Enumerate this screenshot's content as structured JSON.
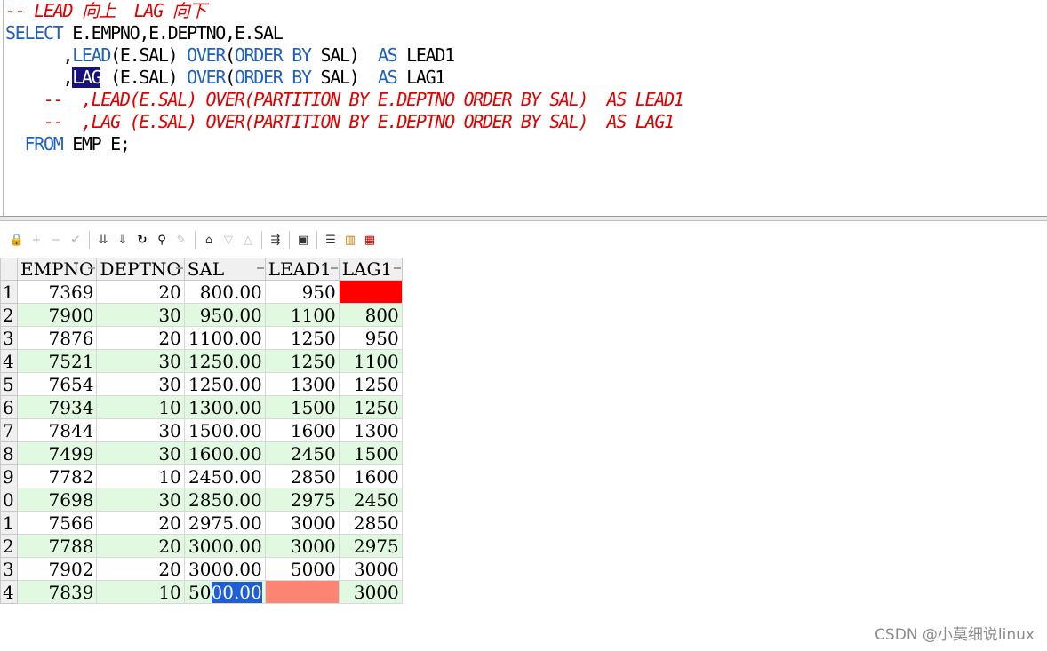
{
  "editor": {
    "lines": [
      {
        "segments": [
          {
            "t": "-- LEAD 向上  LAG 向下",
            "c": "cmt"
          }
        ]
      },
      {
        "segments": [
          {
            "t": "SELECT",
            "c": "kw"
          },
          {
            "t": " E.EMPNO,E.DEPTNO,E.SAL",
            "c": ""
          }
        ]
      },
      {
        "segments": [
          {
            "t": "      ,",
            "c": ""
          },
          {
            "t": "LEAD",
            "c": "kw"
          },
          {
            "t": "(E.SAL) ",
            "c": ""
          },
          {
            "t": "OVER",
            "c": "kw"
          },
          {
            "t": "(",
            "c": ""
          },
          {
            "t": "ORDER BY",
            "c": "kw"
          },
          {
            "t": " SAL)  ",
            "c": ""
          },
          {
            "t": "AS",
            "c": "kw"
          },
          {
            "t": " LEAD1",
            "c": ""
          }
        ]
      },
      {
        "segments": [
          {
            "t": "      ,",
            "c": ""
          },
          {
            "t": "LAG",
            "c": "sel"
          },
          {
            "t": " (E.SAL) ",
            "c": ""
          },
          {
            "t": "OVER",
            "c": "kw"
          },
          {
            "t": "(",
            "c": ""
          },
          {
            "t": "ORDER BY",
            "c": "kw"
          },
          {
            "t": " SAL)  ",
            "c": ""
          },
          {
            "t": "AS",
            "c": "kw"
          },
          {
            "t": " LAG1",
            "c": ""
          }
        ]
      },
      {
        "segments": [
          {
            "t": "    --  ,LEAD(E.SAL) OVER(PARTITION BY E.DEPTNO ORDER BY SAL)  AS LEAD1",
            "c": "cmt"
          }
        ]
      },
      {
        "segments": [
          {
            "t": "    --  ,LAG (E.SAL) OVER(PARTITION BY E.DEPTNO ORDER BY SAL)  AS LAG1",
            "c": "cmt"
          }
        ]
      },
      {
        "segments": [
          {
            "t": "  ",
            "c": ""
          },
          {
            "t": "FROM",
            "c": "kw"
          },
          {
            "t": " EMP E;",
            "c": ""
          }
        ]
      }
    ]
  },
  "toolbar": {
    "icons": [
      "lock-icon",
      "add-row-icon",
      "delete-row-icon",
      "post-changes-icon",
      "|",
      "next-page-icon",
      "last-page-icon",
      "refresh-icon",
      "find-icon",
      "clear-icon",
      "|",
      "query-by-example-icon",
      "sort-desc-icon",
      "sort-asc-icon",
      "|",
      "export-icon",
      "|",
      "save-icon",
      "|",
      "single-record-icon",
      "chart-icon",
      "grid-options-icon"
    ]
  },
  "grid": {
    "columns": [
      "EMPNO",
      "DEPTNO",
      "SAL",
      "LEAD1",
      "LAG1"
    ],
    "rows": [
      {
        "n": "1",
        "empno": "7369",
        "deptno": "20",
        "sal": "800.00",
        "lead1": "950",
        "lag1": ""
      },
      {
        "n": "2",
        "empno": "7900",
        "deptno": "30",
        "sal": "950.00",
        "lead1": "1100",
        "lag1": "800"
      },
      {
        "n": "3",
        "empno": "7876",
        "deptno": "20",
        "sal": "1100.00",
        "lead1": "1250",
        "lag1": "950"
      },
      {
        "n": "4",
        "empno": "7521",
        "deptno": "30",
        "sal": "1250.00",
        "lead1": "1250",
        "lag1": "1100"
      },
      {
        "n": "5",
        "empno": "7654",
        "deptno": "30",
        "sal": "1250.00",
        "lead1": "1300",
        "lag1": "1250"
      },
      {
        "n": "6",
        "empno": "7934",
        "deptno": "10",
        "sal": "1300.00",
        "lead1": "1500",
        "lag1": "1250"
      },
      {
        "n": "7",
        "empno": "7844",
        "deptno": "30",
        "sal": "1500.00",
        "lead1": "1600",
        "lag1": "1300"
      },
      {
        "n": "8",
        "empno": "7499",
        "deptno": "30",
        "sal": "1600.00",
        "lead1": "2450",
        "lag1": "1500"
      },
      {
        "n": "9",
        "empno": "7782",
        "deptno": "10",
        "sal": "2450.00",
        "lead1": "2850",
        "lag1": "1600"
      },
      {
        "n": "0",
        "empno": "7698",
        "deptno": "30",
        "sal": "2850.00",
        "lead1": "2975",
        "lag1": "2450"
      },
      {
        "n": "1",
        "empno": "7566",
        "deptno": "20",
        "sal": "2975.00",
        "lead1": "3000",
        "lag1": "2850"
      },
      {
        "n": "2",
        "empno": "7788",
        "deptno": "20",
        "sal": "3000.00",
        "lead1": "3000",
        "lag1": "2975"
      },
      {
        "n": "3",
        "empno": "7902",
        "deptno": "20",
        "sal": "3000.00",
        "lead1": "5000",
        "lag1": "3000"
      },
      {
        "n": "4",
        "empno": "7839",
        "deptno": "10",
        "sal": "5000.00",
        "lead1": "",
        "lag1": "3000"
      }
    ],
    "selection_prefix": "50",
    "selection_text": "00.00"
  },
  "watermark": "CSDN @小莫细说linux",
  "colors": {
    "keyword": "#1f5fbf",
    "comment": "#e00000",
    "selection": "#16127a",
    "even_row": "#e1f8e1",
    "null_first": "#ff0000",
    "null_last": "#fb8572"
  }
}
